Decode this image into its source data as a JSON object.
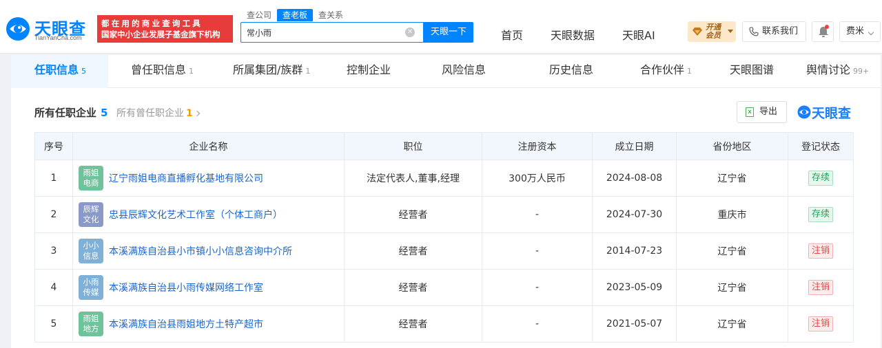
{
  "header": {
    "logo": {
      "cn": "天眼查",
      "en": "TianYanCha.com"
    },
    "slogan": {
      "line1": "都在用的商业查询工具",
      "line2": "国家中小企业发展子基金旗下机构"
    },
    "search_tabs": [
      "查公司",
      "查老板",
      "查关系"
    ],
    "search_value": "常小雨",
    "search_button": "天眼一下",
    "nav": [
      "首页",
      "天眼数据",
      "天眼AI"
    ],
    "vip_label_1": "开通",
    "vip_label_2": "会员",
    "contact": "联系我们",
    "user": "费米"
  },
  "tabs": [
    {
      "label": "任职信息",
      "count": "5"
    },
    {
      "label": "曾任职信息",
      "count": "1"
    },
    {
      "label": "所属集团/族群",
      "count": "1"
    },
    {
      "label": "控制企业",
      "count": ""
    },
    {
      "label": "风险信息",
      "count": ""
    },
    {
      "label": "历史信息",
      "count": ""
    },
    {
      "label": "合作伙伴",
      "count": "1"
    },
    {
      "label": "天眼图谱",
      "count": ""
    },
    {
      "label": "舆情讨论",
      "count": "99+"
    }
  ],
  "section": {
    "title": "所有任职企业",
    "count": "5",
    "former_label": "所有曾任职企业",
    "former_count": "1",
    "export": "导出",
    "brand": "天眼查"
  },
  "table": {
    "headers": [
      "序号",
      "企业名称",
      "职位",
      "注册资本",
      "成立日期",
      "省份地区",
      "登记状态"
    ],
    "rows": [
      {
        "no": "1",
        "avatar": [
          "雨姐",
          "电商"
        ],
        "avatar_color": "#6fc39a",
        "name": "辽宁雨姐电商直播孵化基地有限公司",
        "position": "法定代表人,董事,经理",
        "capital": "300万人民币",
        "date": "2024-08-08",
        "region": "辽宁省",
        "status": "存续",
        "status_type": "ok"
      },
      {
        "no": "2",
        "avatar": [
          "辰辉",
          "文化"
        ],
        "avatar_color": "#8a9ac8",
        "name": "忠县辰辉文化艺术工作室（个体工商户）",
        "position": "经营者",
        "capital": "-",
        "date": "2024-07-30",
        "region": "重庆市",
        "status": "存续",
        "status_type": "ok"
      },
      {
        "no": "3",
        "avatar": [
          "小小",
          "信息"
        ],
        "avatar_color": "#7fb0d8",
        "name": "本溪满族自治县小市镇小小信息咨询中介所",
        "position": "经营者",
        "capital": "-",
        "date": "2014-07-23",
        "region": "辽宁省",
        "status": "注销",
        "status_type": "cancel"
      },
      {
        "no": "4",
        "avatar": [
          "小雨",
          "传媒"
        ],
        "avatar_color": "#7fb0d8",
        "name": "本溪满族自治县小雨传媒网络工作室",
        "position": "经营者",
        "capital": "-",
        "date": "2023-05-09",
        "region": "辽宁省",
        "status": "注销",
        "status_type": "cancel"
      },
      {
        "no": "5",
        "avatar": [
          "雨姐",
          "地方"
        ],
        "avatar_color": "#6fc39a",
        "name": "本溪满族自治县雨姐地方土特产超市",
        "position": "经营者",
        "capital": "-",
        "date": "2021-05-07",
        "region": "辽宁省",
        "status": "注销",
        "status_type": "cancel"
      }
    ]
  },
  "colors": {
    "accent": "#0084ff",
    "slogan_bg": "#e83b3b",
    "ok": "#21a35a",
    "cancel": "#e04848"
  }
}
